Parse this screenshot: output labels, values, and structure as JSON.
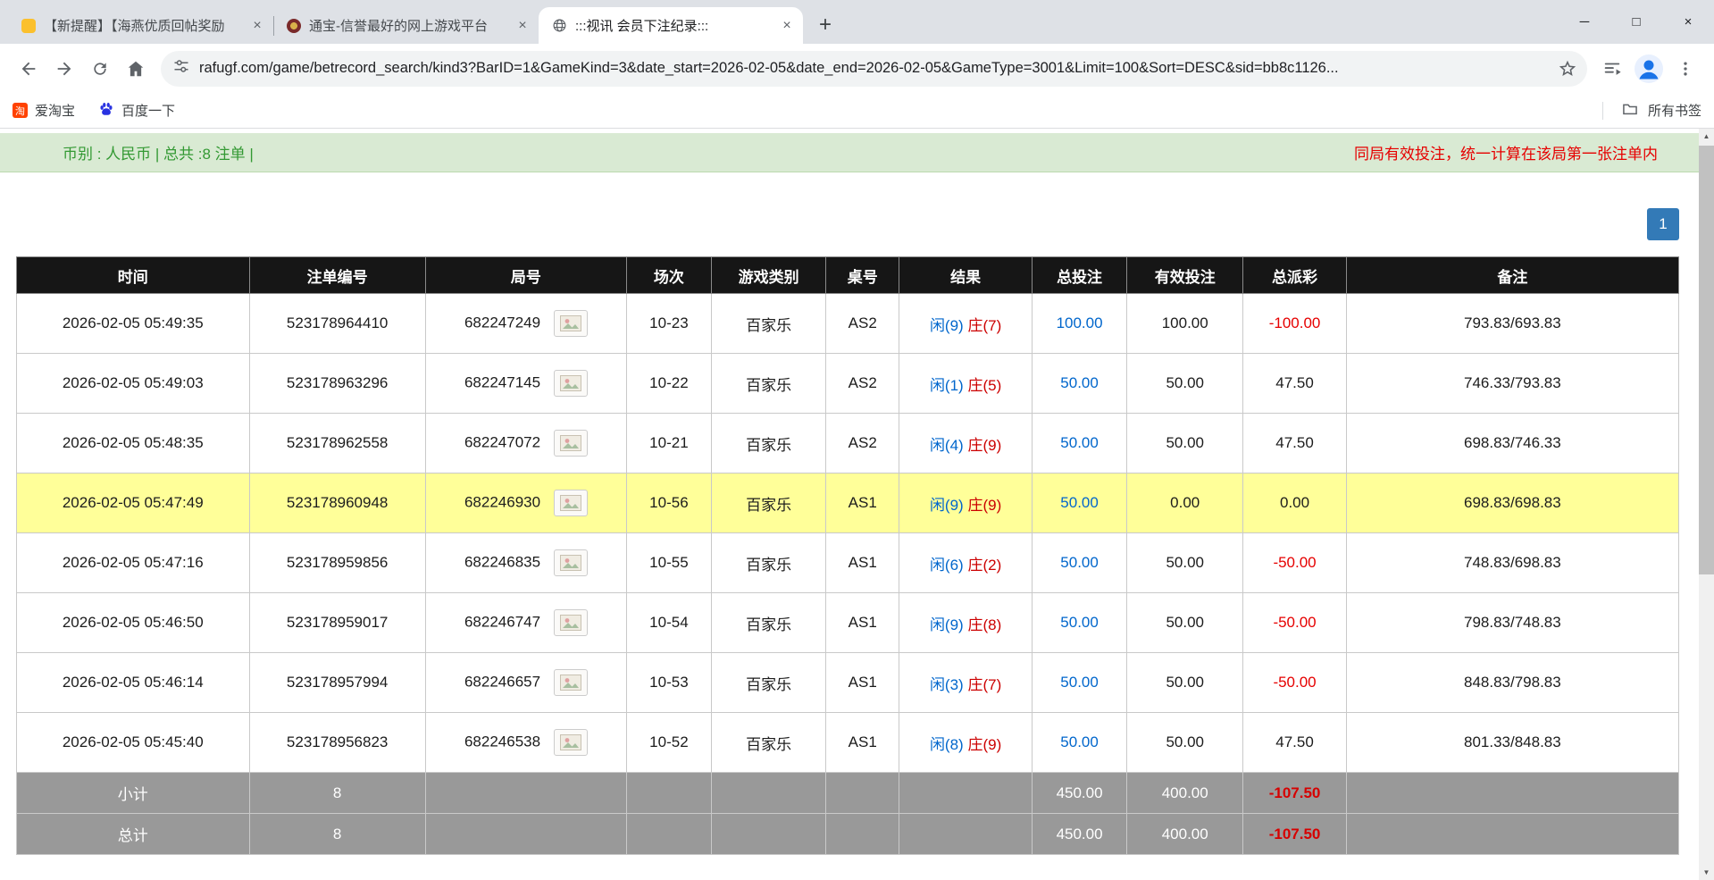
{
  "browser": {
    "tabs": [
      {
        "title": "【新提醒】【海燕优质回帖奖励"
      },
      {
        "title": "通宝-信誉最好的网上游戏平台"
      },
      {
        "title": ":::视讯 会员下注纪录:::"
      }
    ],
    "url": "rafugf.com/game/betrecord_search/kind3?BarID=1&GameKind=3&date_start=2026-02-05&date_end=2026-02-05&GameType=3001&Limit=100&Sort=DESC&sid=bb8c1126...",
    "bookmarks": [
      {
        "label": "爱淘宝",
        "badge": "淘"
      },
      {
        "label": "百度一下"
      }
    ],
    "all_bookmarks": "所有书签"
  },
  "icons": {
    "minimize": "─",
    "maximize": "□",
    "close": "×",
    "tab_close": "×",
    "new_tab": "+",
    "scroll_up": "▲",
    "scroll_down": "▼"
  },
  "page": {
    "summary": "币别 : 人民币 | 总共 :8 注单 |",
    "notice": "同局有效投注，统一计算在该局第一张注单内",
    "page_number": "1"
  },
  "table": {
    "headers": [
      "时间",
      "注单编号",
      "局号",
      "场次",
      "游戏类别",
      "桌号",
      "结果",
      "总投注",
      "有效投注",
      "总派彩",
      "备注"
    ],
    "rows": [
      {
        "time": "2026-02-05 05:49:35",
        "bet_id": "523178964410",
        "round": "682247249",
        "session": "10-23",
        "game": "百家乐",
        "table_no": "AS2",
        "player": "闲(9)",
        "banker": "庄(7)",
        "total_bet": "100.00",
        "valid_bet": "100.00",
        "payout": "-100.00",
        "note": "793.83/693.83",
        "highlight": false
      },
      {
        "time": "2026-02-05 05:49:03",
        "bet_id": "523178963296",
        "round": "682247145",
        "session": "10-22",
        "game": "百家乐",
        "table_no": "AS2",
        "player": "闲(1)",
        "banker": "庄(5)",
        "total_bet": "50.00",
        "valid_bet": "50.00",
        "payout": "47.50",
        "note": "746.33/793.83",
        "highlight": false
      },
      {
        "time": "2026-02-05 05:48:35",
        "bet_id": "523178962558",
        "round": "682247072",
        "session": "10-21",
        "game": "百家乐",
        "table_no": "AS2",
        "player": "闲(4)",
        "banker": "庄(9)",
        "total_bet": "50.00",
        "valid_bet": "50.00",
        "payout": "47.50",
        "note": "698.83/746.33",
        "highlight": false
      },
      {
        "time": "2026-02-05 05:47:49",
        "bet_id": "523178960948",
        "round": "682246930",
        "session": "10-56",
        "game": "百家乐",
        "table_no": "AS1",
        "player": "闲(9)",
        "banker": "庄(9)",
        "total_bet": "50.00",
        "valid_bet": "0.00",
        "payout": "0.00",
        "note": "698.83/698.83",
        "highlight": true
      },
      {
        "time": "2026-02-05 05:47:16",
        "bet_id": "523178959856",
        "round": "682246835",
        "session": "10-55",
        "game": "百家乐",
        "table_no": "AS1",
        "player": "闲(6)",
        "banker": "庄(2)",
        "total_bet": "50.00",
        "valid_bet": "50.00",
        "payout": "-50.00",
        "note": "748.83/698.83",
        "highlight": false
      },
      {
        "time": "2026-02-05 05:46:50",
        "bet_id": "523178959017",
        "round": "682246747",
        "session": "10-54",
        "game": "百家乐",
        "table_no": "AS1",
        "player": "闲(9)",
        "banker": "庄(8)",
        "total_bet": "50.00",
        "valid_bet": "50.00",
        "payout": "-50.00",
        "note": "798.83/748.83",
        "highlight": false
      },
      {
        "time": "2026-02-05 05:46:14",
        "bet_id": "523178957994",
        "round": "682246657",
        "session": "10-53",
        "game": "百家乐",
        "table_no": "AS1",
        "player": "闲(3)",
        "banker": "庄(7)",
        "total_bet": "50.00",
        "valid_bet": "50.00",
        "payout": "-50.00",
        "note": "848.83/798.83",
        "highlight": false
      },
      {
        "time": "2026-02-05 05:45:40",
        "bet_id": "523178956823",
        "round": "682246538",
        "session": "10-52",
        "game": "百家乐",
        "table_no": "AS1",
        "player": "闲(8)",
        "banker": "庄(9)",
        "total_bet": "50.00",
        "valid_bet": "50.00",
        "payout": "47.50",
        "note": "801.33/848.83",
        "highlight": false
      }
    ],
    "summary_rows": [
      {
        "label": "小计",
        "count": "8",
        "total_bet": "450.00",
        "valid_bet": "400.00",
        "payout": "-107.50"
      },
      {
        "label": "总计",
        "count": "8",
        "total_bet": "450.00",
        "valid_bet": "400.00",
        "payout": "-107.50"
      }
    ]
  },
  "colors": {
    "player_blue": "#0066cc",
    "banker_red": "#cc0000",
    "negative_red": "#e60000",
    "highlight_yellow": "#ffff99",
    "header_bg": "#161616",
    "summary_bg": "#999999",
    "greenbar_bg": "#d9ead3",
    "greenbar_text": "#339933",
    "notice_red": "#e60000",
    "page_btn_blue": "#337ab7"
  }
}
